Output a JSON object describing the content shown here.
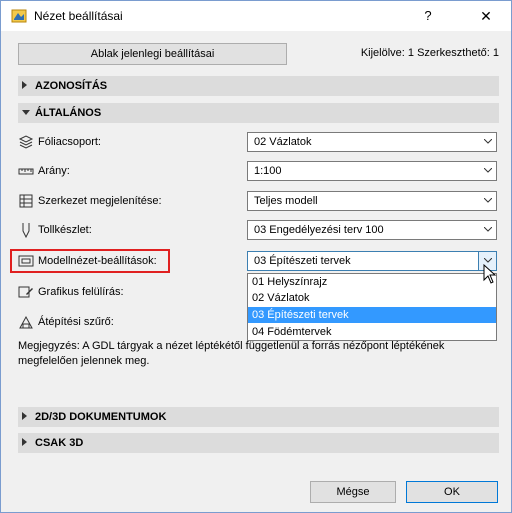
{
  "window": {
    "title": "Nézet beállításai",
    "help_label": "?",
    "close_label": "✕"
  },
  "toolbar": {
    "current_settings_button": "Ablak jelenlegi beállításai",
    "selection_info": "Kijelölve: 1 Szerkeszthető: 1"
  },
  "sections": {
    "identification": "AZONOSÍTÁS",
    "general": "ÁLTALÁNOS",
    "doc2d3d": "2D/3D DOKUMENTUMOK",
    "only3d": "CSAK 3D"
  },
  "fields": {
    "layer_group": {
      "label": "Fóliacsoport:",
      "value": "02 Vázlatok",
      "icon": "layers-icon"
    },
    "scale": {
      "label": "Arány:",
      "value": "1:100",
      "icon": "scale-ruler-icon"
    },
    "structure_display": {
      "label": "Szerkezet megjelenítése:",
      "value": "Teljes modell",
      "icon": "structure-icon"
    },
    "pen_set": {
      "label": "Tollkészlet:",
      "value": "03 Engedélyezési terv 100",
      "icon": "pen-icon"
    },
    "model_view": {
      "label": "Modellnézet-beállítások:",
      "value": "03 Építészeti tervek",
      "icon": "model-view-icon"
    },
    "graphic_override": {
      "label": "Grafikus felülírás:",
      "icon": "graphic-override-icon"
    },
    "renovation_filter": {
      "label": "Átépítési szűrő:",
      "icon": "renovation-icon"
    }
  },
  "model_view_options": [
    "01 Helyszínrajz",
    "02 Vázlatok",
    "03 Építészeti tervek",
    "04 Födémtervek"
  ],
  "model_view_selected_index": 2,
  "note": "Megjegyzés: A GDL tárgyak a nézet léptékétől függetlenül a forrás nézőpont léptékének megfelelően jelennek meg.",
  "footer": {
    "cancel_label": "Mégse",
    "ok_label": "OK"
  },
  "colors": {
    "highlight_border": "#e02020",
    "selected_item_bg": "#3399ff",
    "section_bg": "#dcdcdc"
  }
}
